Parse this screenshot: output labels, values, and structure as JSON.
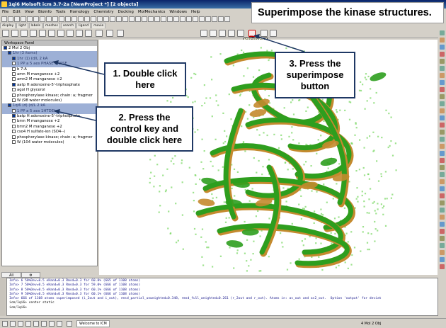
{
  "window": {
    "title": "1qi6 Molsoft icm 3.7-2a [NewProject *] [2 objects]"
  },
  "menu": [
    "File",
    "Edit",
    "View",
    "Bioinfo",
    "Tools",
    "Homology",
    "Chemistry",
    "Docking",
    "MolMechanics",
    "Windows",
    "Help"
  ],
  "tabs": [
    "display",
    "light",
    "labels",
    "meshes",
    "search",
    "ligand",
    "movie"
  ],
  "superimpose_tooltip": "Superimpose",
  "panel": {
    "title": "Workspace Panel",
    "root": "2 Mol 2 Obj",
    "rows": [
      {
        "id": "1",
        "type": "",
        "label": "1hr (3 items)",
        "sel": true,
        "checked": true,
        "depth": 1
      },
      {
        "id": "2",
        "type": "",
        "label": "1hr (1) (d/L 2 kA",
        "sel": true,
        "checked": true,
        "depth": 2
      },
      {
        "id": "3",
        "type": "",
        "label": "1 PP a 5 aes PHASE PHASE",
        "sel": true,
        "checked": false,
        "depth": 2
      },
      {
        "id": "4",
        "type": "",
        "label": "b   7-A",
        "sel": false,
        "checked": false,
        "depth": 2
      },
      {
        "id": "5",
        "type": "H",
        "label": "amn   M   manganese +2",
        "sel": false,
        "checked": false,
        "depth": 2
      },
      {
        "id": "6",
        "type": "H",
        "label": "amn2   M   manganese +2",
        "sel": false,
        "checked": false,
        "depth": 2
      },
      {
        "id": "7",
        "type": "H",
        "label": "aatp   H   adenosine-5'-triphosphate",
        "sel": false,
        "checked": true,
        "depth": 2
      },
      {
        "id": "8",
        "type": "H",
        "label": "agol   H   glycerol",
        "sel": false,
        "checked": false,
        "depth": 2
      },
      {
        "id": "9",
        "type": "",
        "label": "phosphorylase kinase; chain: a; fragmer",
        "sel": false,
        "checked": false,
        "depth": 2
      },
      {
        "id": "10",
        "type": "",
        "label": "W   (98 water molecules)",
        "sel": false,
        "checked": false,
        "depth": 2
      },
      {
        "id": "11",
        "type": "",
        "label": "1qi6 (d) (d/L 2 kA",
        "sel": true,
        "checked": true,
        "depth": 1
      },
      {
        "id": "12",
        "type": "",
        "label": "1 PP a 5 aes 1HTDEL",
        "sel": true,
        "checked": false,
        "depth": 2
      },
      {
        "id": "13",
        "type": "H",
        "label": "batp   H   adenosine-5'-triphosphate",
        "sel": false,
        "checked": true,
        "depth": 2
      },
      {
        "id": "14",
        "type": "H",
        "label": "bmn   M   manganese +2",
        "sel": false,
        "checked": false,
        "depth": 2
      },
      {
        "id": "15",
        "type": "H",
        "label": "bmn2   M   manganese +2",
        "sel": false,
        "checked": false,
        "depth": 2
      },
      {
        "id": "16",
        "type": "H",
        "label": "cso4   H   sulfate-ion (SO4--)",
        "sel": false,
        "checked": false,
        "depth": 2
      },
      {
        "id": "17",
        "type": "",
        "label": "phosphorylase kinase; chain: a; fragmer",
        "sel": false,
        "checked": false,
        "depth": 2
      },
      {
        "id": "18",
        "type": "",
        "label": "W   (104 water molecules)",
        "sel": false,
        "checked": false,
        "depth": 2
      }
    ]
  },
  "bottom_tabs": [
    "All"
  ],
  "console_lines": [
    "Info> 6 50%Dev=0.5 eHand=0.3 Rmsd=0.3 for 60.0% (665 of 1108 atoms)",
    "Info> 7 50%Dev=0.5 eHand=0.3 Rmsd=0.3 for 59.0% (666 of 1108 atoms)",
    "Info> 8 50%Dev=0.5 eHand=0.3 Rmsd=0.3 for 60.1% (666 of 1108 atoms)",
    "Info> 9 50%Dev=0.5 eHand=0.3 Rmsd=0.3 for 60.1% (666 of 1108 atoms)",
    "Info> 666 of 1108 atoms superimposed (i_2out and i_out), rmsd_partial_unweighted=0.348, rmsd_full_weighted=0.261 (r_2out and r_out). Atoms in: as_out and as2_out.  Option 'output' for deviat",
    "icm/1qi6> center static",
    "icm/1qi6>"
  ],
  "status": {
    "message": "Welcome to ICM",
    "right": "4 Mol 2 Obj"
  },
  "callouts": {
    "title": "Superimpose the kinase structures.",
    "step1": [
      "1. Double click",
      "here"
    ],
    "step2": [
      "2. Press the",
      "control key and",
      "double click here"
    ],
    "step3": [
      "3. Press the",
      "superimpose",
      "button"
    ]
  },
  "palette_colors": [
    "#000000",
    "#7f7f7f",
    "#ffffff",
    "#ff0000",
    "#ff8000",
    "#ffff00",
    "#80ff00",
    "#00ff00",
    "#00ffff",
    "#0080ff",
    "#0000ff",
    "#8000ff",
    "#ff00ff",
    "#ff80c0",
    "#c08040",
    "#804000",
    "#408080"
  ],
  "protein_colors": {
    "mol1": "#2e9e1e",
    "mol2": "#c48a2e",
    "water": "#7fd86a"
  }
}
